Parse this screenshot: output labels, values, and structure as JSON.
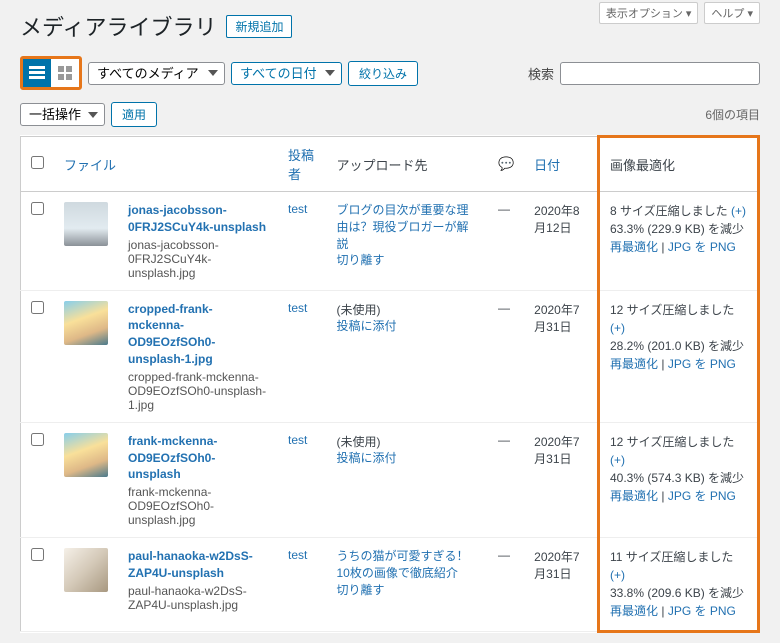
{
  "header": {
    "title": "メディアライブラリ",
    "addNew": "新規追加"
  },
  "screenOptions": {
    "opts": "表示オプション ▾",
    "help": "ヘルプ ▾"
  },
  "filters": {
    "mediaType": "すべてのメディア",
    "allDates": "すべての日付",
    "filter": "絞り込み",
    "searchLabel": "検索"
  },
  "bulk": {
    "action": "一括操作",
    "apply": "適用",
    "count": "6個の項目"
  },
  "columns": {
    "file": "ファイル",
    "author": "投稿者",
    "uploadedTo": "アップロード先",
    "comments": "💬",
    "date": "日付",
    "opt": "画像最適化"
  },
  "common": {
    "detach": "切り離す",
    "reopt": "再最適化",
    "jpgToPng": "JPG を PNG",
    "attach": "投稿に添付",
    "unused": "(未使用)",
    "author": "test",
    "sep": " | ",
    "plus": "(+)"
  },
  "rows": [
    {
      "title": "jonas-jacobsson-0FRJ2SCuY4k-unsplash",
      "filename": "jonas-jacobsson-0FRJ2SCuY4k-unsplash.jpg",
      "thumb": "linear-gradient(180deg,#cfd9df 0%,#e2ebf0 60%,#8b9198 100%)",
      "uploadTitle": "ブログの目次が重要な理由は？現役ブロガーが解説",
      "uploadAction": "detach",
      "date": "2020年8月12日",
      "optLine1": "8 サイズ圧縮しました",
      "optLine2": "63.3% (229.9 KB) を減少"
    },
    {
      "title": "cropped-frank-mckenna-OD9EOzfSOh0-unsplash-1.jpg",
      "filename": "cropped-frank-mckenna-OD9EOzfSOh0-unsplash-1.jpg",
      "thumb": "linear-gradient(160deg,#87ceeb 0%,#f9e09a 40%,#deb887 70%,#4a7a8c 100%)",
      "uploadTitle": "",
      "uploadAction": "attach",
      "date": "2020年7月31日",
      "optLine1": "12 サイズ圧縮しました",
      "optLine2": "28.2% (201.0 KB) を減少"
    },
    {
      "title": "frank-mckenna-OD9EOzfSOh0-unsplash",
      "filename": "frank-mckenna-OD9EOzfSOh0-unsplash.jpg",
      "thumb": "linear-gradient(160deg,#87ceeb 0%,#f9e09a 40%,#deb887 70%,#4a7a8c 100%)",
      "uploadTitle": "",
      "uploadAction": "attach",
      "date": "2020年7月31日",
      "optLine1": "12 サイズ圧縮しました",
      "optLine2": "40.3% (574.3 KB) を減少"
    },
    {
      "title": "paul-hanaoka-w2DsS-ZAP4U-unsplash",
      "filename": "paul-hanaoka-w2DsS-ZAP4U-unsplash.jpg",
      "thumb": "linear-gradient(135deg,#f5f0e8 0%,#d4c9b8 50%,#a89880 100%)",
      "uploadTitle": "うちの猫が可愛すぎる！10枚の画像で徹底紹介",
      "uploadAction": "detach",
      "date": "2020年7月31日",
      "optLine1": "11 サイズ圧縮しました",
      "optLine2": "33.8% (209.6 KB) を減少"
    }
  ]
}
